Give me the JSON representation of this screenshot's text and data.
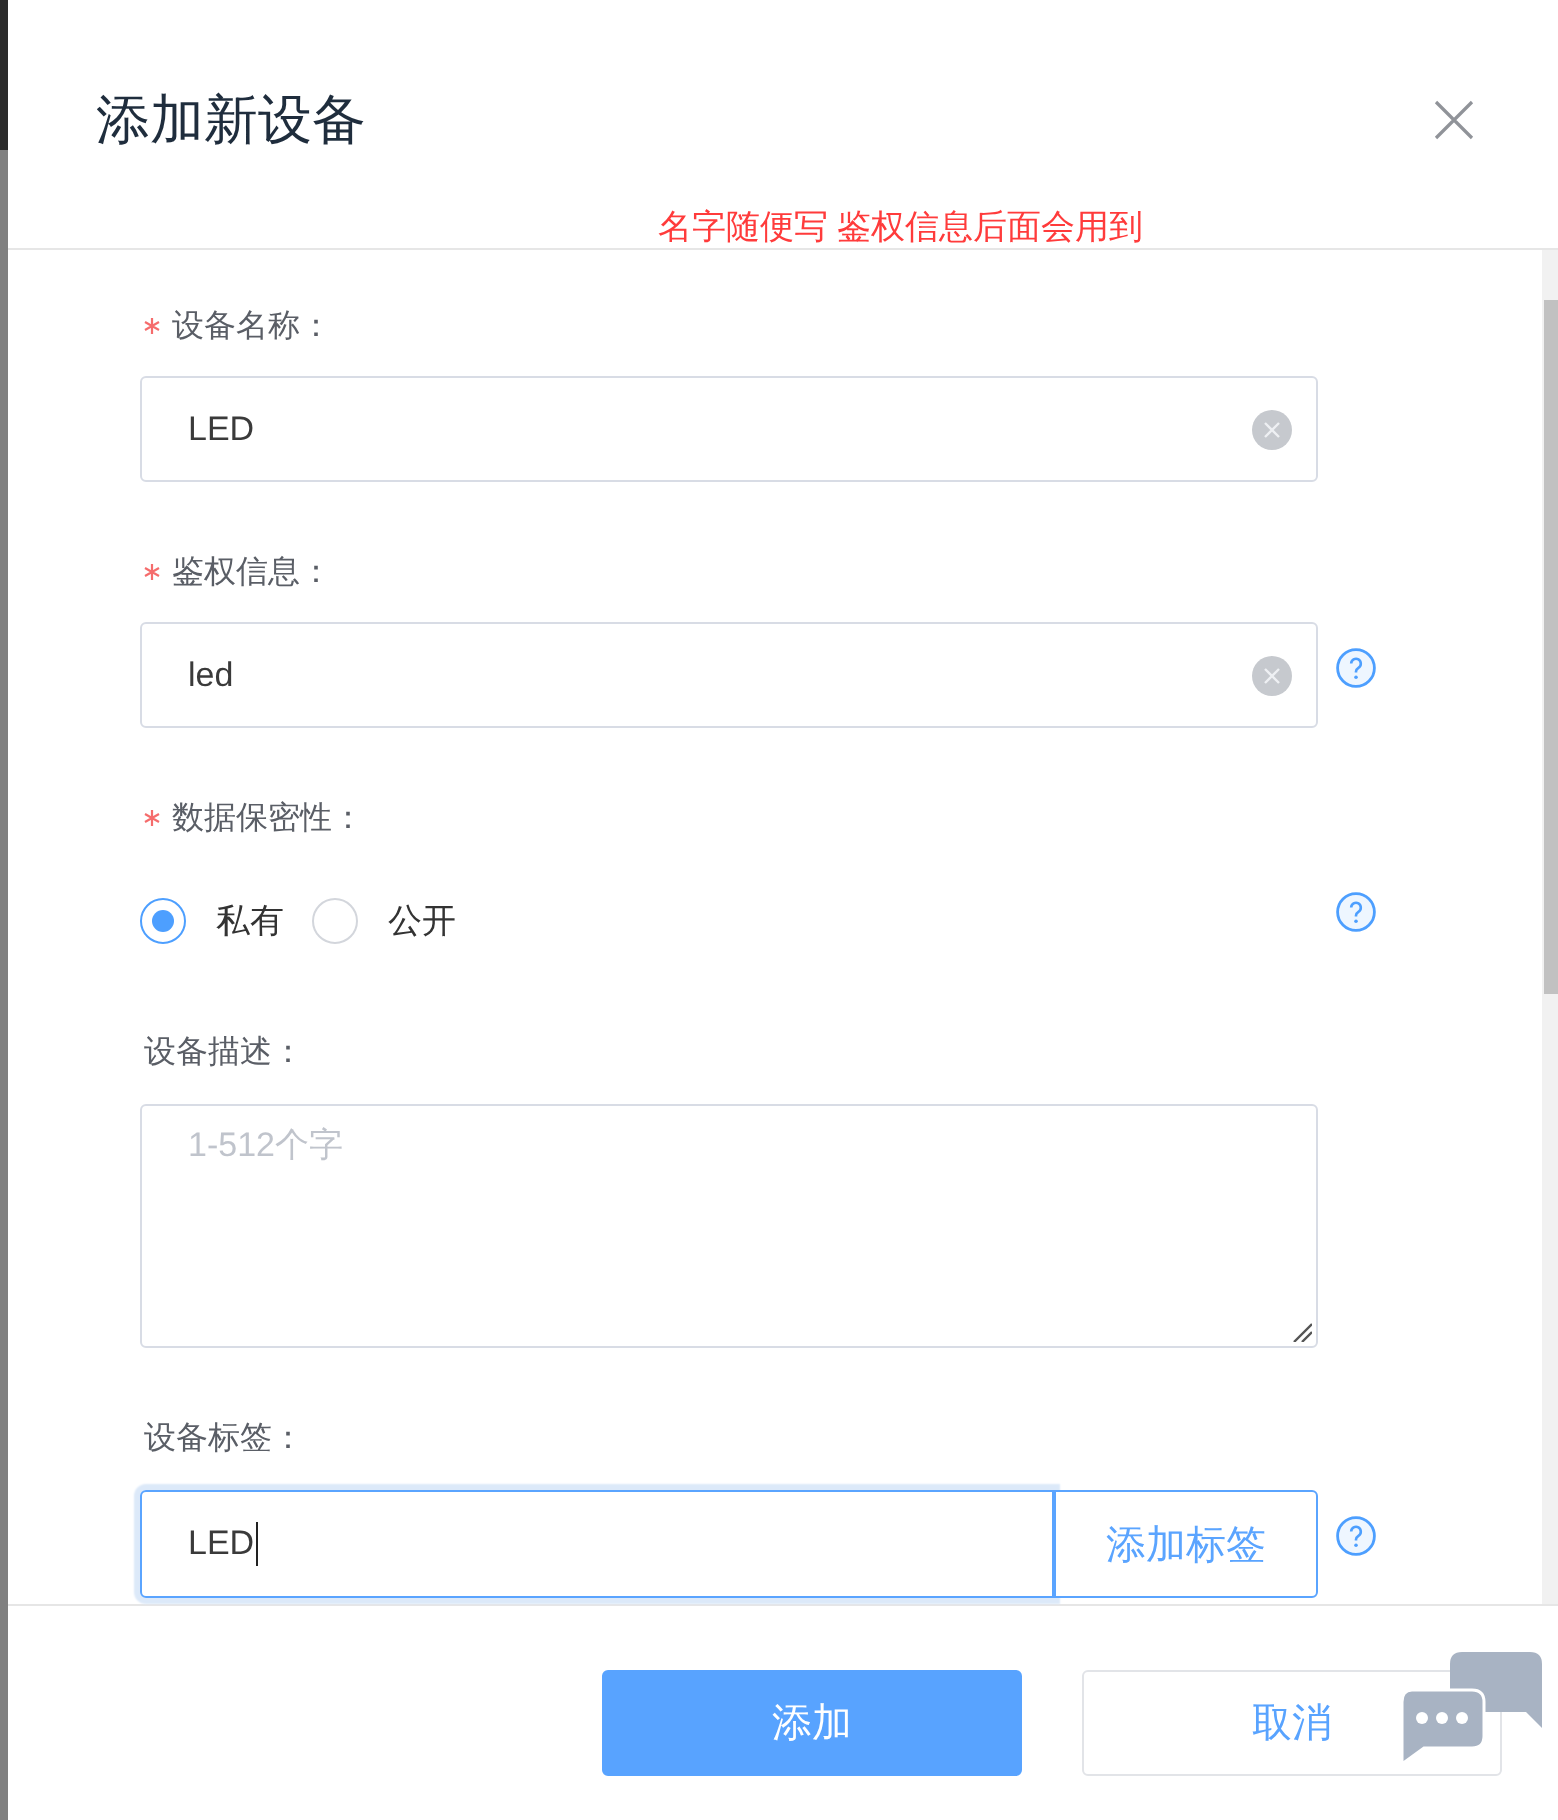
{
  "dialog": {
    "title": "添加新设备",
    "annotation": "名字随便写 鉴权信息后面会用到"
  },
  "form": {
    "fields": [
      {
        "kind": "text",
        "label": "设备名称：",
        "required": true,
        "value": "LED",
        "clearable": true,
        "help": false
      },
      {
        "kind": "text",
        "label": "鉴权信息：",
        "required": true,
        "value": "led",
        "clearable": true,
        "help": true
      },
      {
        "kind": "radio",
        "label": "数据保密性：",
        "required": true,
        "options": [
          {
            "label": "私有",
            "selected": true
          },
          {
            "label": "公开",
            "selected": false
          }
        ],
        "help": true
      },
      {
        "kind": "textarea",
        "label": "设备描述：",
        "required": false,
        "placeholder": "1-512个字",
        "help": false
      },
      {
        "kind": "tag",
        "label": "设备标签：",
        "required": false,
        "value": "LED",
        "focused": true,
        "button": "添加标签",
        "help": true
      }
    ]
  },
  "footer": {
    "buttons": [
      {
        "label": "添加",
        "kind": "primary"
      },
      {
        "label": "取消",
        "kind": "default"
      }
    ]
  }
}
